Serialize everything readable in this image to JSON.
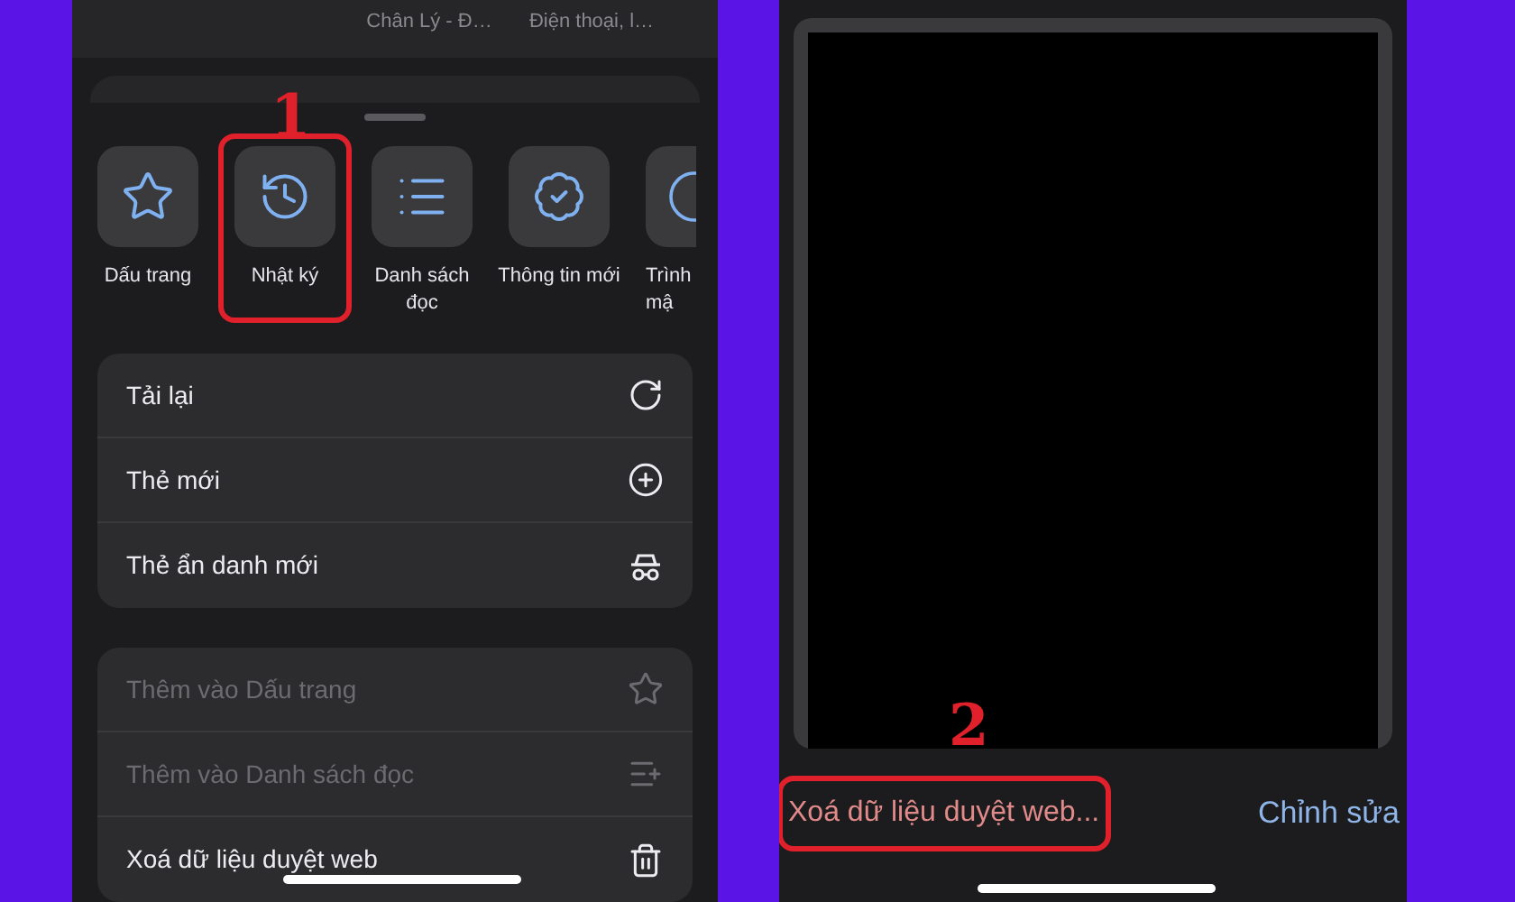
{
  "left_screen": {
    "shortcut_captions": [
      "Chân Lý - Đ…",
      "Điện thoại, l…"
    ],
    "quick_actions": [
      {
        "label": "Dấu trang",
        "kind": "star",
        "highlighted": false
      },
      {
        "label": "Nhật ký",
        "kind": "history",
        "highlighted": true
      },
      {
        "label": "Danh sách đọc",
        "kind": "list",
        "highlighted": false
      },
      {
        "label": "Thông tin mới",
        "kind": "badge",
        "highlighted": false
      },
      {
        "label": "Trình mậ",
        "kind": "partial",
        "highlighted": false
      }
    ],
    "menu_groups": [
      [
        {
          "label": "Tải lại",
          "kind": "reload",
          "disabled": false
        },
        {
          "label": "Thẻ mới",
          "kind": "plus",
          "disabled": false
        },
        {
          "label": "Thẻ ẩn danh mới",
          "kind": "incognito",
          "disabled": false
        }
      ],
      [
        {
          "label": "Thêm vào Dấu trang",
          "kind": "star",
          "disabled": true
        },
        {
          "label": "Thêm vào Danh sách đọc",
          "kind": "listadd",
          "disabled": true
        },
        {
          "label": "Xoá dữ liệu duyệt web",
          "kind": "trash",
          "disabled": false
        }
      ]
    ],
    "step_number": "1"
  },
  "right_screen": {
    "step_number": "2",
    "clear_button": {
      "label": "Xoá dữ liệu duyệt web...",
      "highlighted": true
    },
    "edit_button": {
      "label": "Chỉnh sửa"
    }
  }
}
